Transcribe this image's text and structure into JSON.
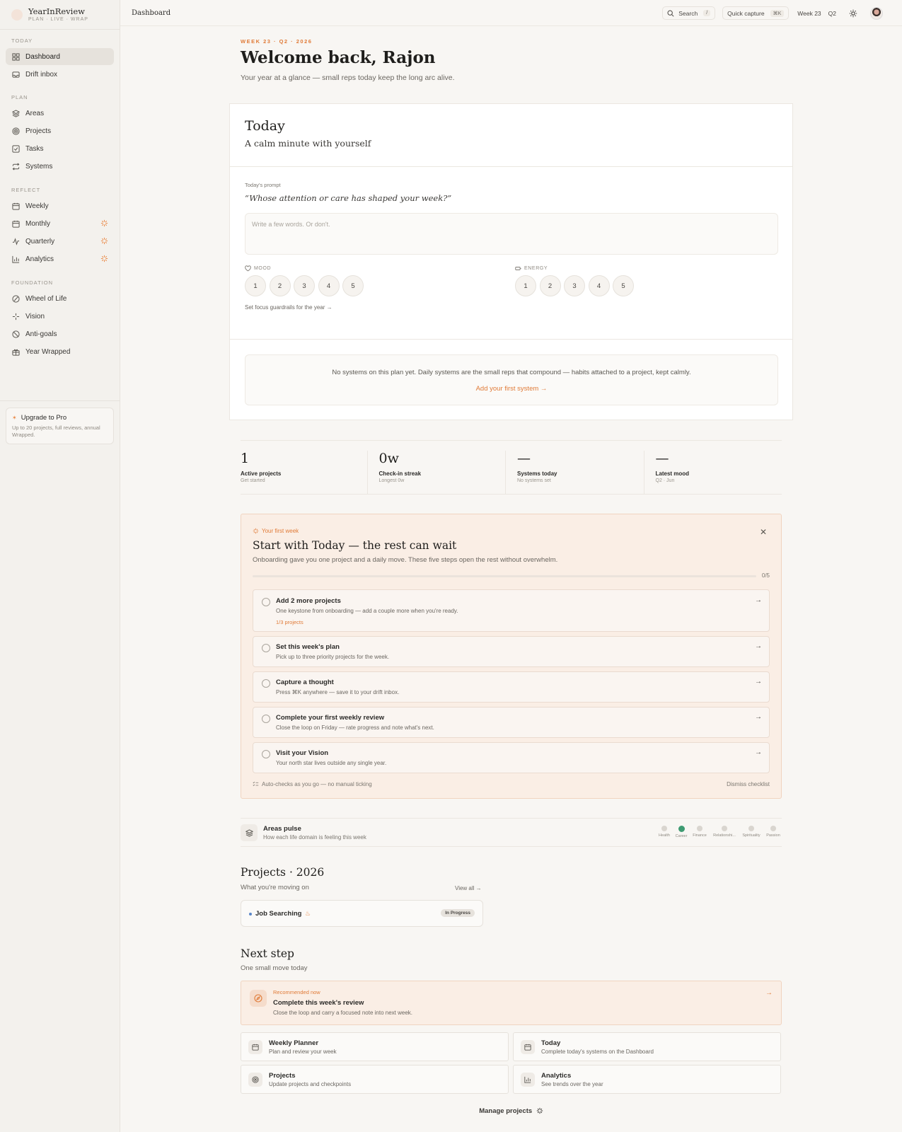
{
  "brand": {
    "name": "YearInReview",
    "tagline": "PLAN · LIVE · WRAP"
  },
  "sidebar": {
    "sections": [
      {
        "label": "TODAY",
        "items": [
          {
            "label": "Dashboard",
            "icon": "dashboard-icon",
            "active": true
          },
          {
            "label": "Drift inbox",
            "icon": "inbox-icon"
          }
        ]
      },
      {
        "label": "PLAN",
        "items": [
          {
            "label": "Areas",
            "icon": "layers-icon"
          },
          {
            "label": "Projects",
            "icon": "target-icon"
          },
          {
            "label": "Tasks",
            "icon": "checkbox-icon"
          },
          {
            "label": "Systems",
            "icon": "repeat-icon"
          }
        ]
      },
      {
        "label": "REFLECT",
        "items": [
          {
            "label": "Weekly",
            "icon": "calendar-icon"
          },
          {
            "label": "Monthly",
            "icon": "calendar-icon",
            "pro": true
          },
          {
            "label": "Quarterly",
            "icon": "activity-icon",
            "pro": true
          },
          {
            "label": "Analytics",
            "icon": "bar-chart-icon",
            "pro": true
          }
        ]
      },
      {
        "label": "FOUNDATION",
        "items": [
          {
            "label": "Wheel of Life",
            "icon": "wheel-icon"
          },
          {
            "label": "Vision",
            "icon": "sparkle-icon"
          },
          {
            "label": "Anti-goals",
            "icon": "ban-icon"
          },
          {
            "label": "Year Wrapped",
            "icon": "gift-icon"
          }
        ]
      }
    ],
    "upgrade": {
      "title": "Upgrade to Pro",
      "desc": "Up to 20 projects, full reviews, annual Wrapped."
    }
  },
  "topbar": {
    "crumb": "Dashboard",
    "search_label": "Search",
    "search_kbd": "/",
    "capture_label": "Quick capture",
    "capture_kbd": "⌘K",
    "week": "Week 23",
    "quarter": "Q2"
  },
  "header": {
    "eyebrow": "WEEK 23 · Q2 · 2026",
    "title": "Welcome back, Rajon",
    "subtitle": "Your year at a glance — small reps today keep the long arc alive."
  },
  "today": {
    "title": "Today",
    "subtitle": "A calm minute with yourself",
    "prompt_label": "Today's prompt",
    "prompt": "“Whose attention or care has shaped your week?”",
    "input_placeholder": "Write a few words. Or don't.",
    "mood_label": "MOOD",
    "energy_label": "ENERGY",
    "scale": [
      "1",
      "2",
      "3",
      "4",
      "5"
    ],
    "guardrails_link": "Set focus guardrails for the year →",
    "systems_empty": "No systems on this plan yet. Daily systems are the small reps that compound — habits attached to a project, kept calmly.",
    "systems_cta": "Add your first system →"
  },
  "stats": [
    {
      "value": "1",
      "label": "Active projects",
      "sub": "Get started"
    },
    {
      "value": "0w",
      "label": "Check-in streak",
      "sub": "Longest 0w"
    },
    {
      "value": "—",
      "label": "Systems today",
      "sub": "No systems set"
    },
    {
      "value": "—",
      "label": "Latest mood",
      "sub": "Q2 · Jun"
    }
  ],
  "onboarding": {
    "eyebrow": "Your first week",
    "title": "Start with Today — the rest can wait",
    "subtitle": "Onboarding gave you one project and a daily move. These five steps open the rest without overwhelm.",
    "progress": 0,
    "progress_label": "0/5",
    "steps": [
      {
        "title": "Add 2 more projects",
        "desc": "One keystone from onboarding — add a couple more when you're ready.",
        "meta": "1/3 projects"
      },
      {
        "title": "Set this week's plan",
        "desc": "Pick up to three priority projects for the week."
      },
      {
        "title": "Capture a thought",
        "desc": "Press ⌘K anywhere — save it to your drift inbox."
      },
      {
        "title": "Complete your first weekly review",
        "desc": "Close the loop on Friday — rate progress and note what's next."
      },
      {
        "title": "Visit your Vision",
        "desc": "Your north star lives outside any single year."
      }
    ],
    "footer": "Auto-checks as you go — no manual ticking",
    "dismiss": "Dismiss checklist"
  },
  "areas_pulse": {
    "title": "Areas pulse",
    "subtitle": "How each life domain is feeling this week",
    "areas": [
      {
        "label": "Health",
        "active": false
      },
      {
        "label": "Career",
        "active": true
      },
      {
        "label": "Finance",
        "active": false
      },
      {
        "label": "Relationshi...",
        "active": false
      },
      {
        "label": "Spirituality",
        "active": false
      },
      {
        "label": "Passion",
        "active": false
      }
    ]
  },
  "projects": {
    "title": "Projects · 2026",
    "subtitle": "What you're moving on",
    "view_all": "View all →",
    "items": [
      {
        "name": "Job Searching",
        "status": "In Progress"
      }
    ]
  },
  "next_step": {
    "title": "Next step",
    "subtitle": "One small move today",
    "recommended": {
      "eyebrow": "Recommended now",
      "title": "Complete this week's review",
      "desc": "Close the loop and carry a focused note into next week."
    },
    "quick_links": [
      {
        "title": "Weekly Planner",
        "desc": "Plan and review your week",
        "icon": "calendar-icon"
      },
      {
        "title": "Today",
        "desc": "Complete today's systems on the Dashboard",
        "icon": "calendar-icon"
      },
      {
        "title": "Projects",
        "desc": "Update projects and checkpoints",
        "icon": "target-icon"
      },
      {
        "title": "Analytics",
        "desc": "See trends over the year",
        "icon": "bar-chart-icon"
      }
    ],
    "manage": "Manage projects"
  },
  "colors": {
    "accent": "#e07b38",
    "background": "#f8f6f3",
    "sidebar": "#f3f1ed",
    "success": "#3e9b72"
  }
}
